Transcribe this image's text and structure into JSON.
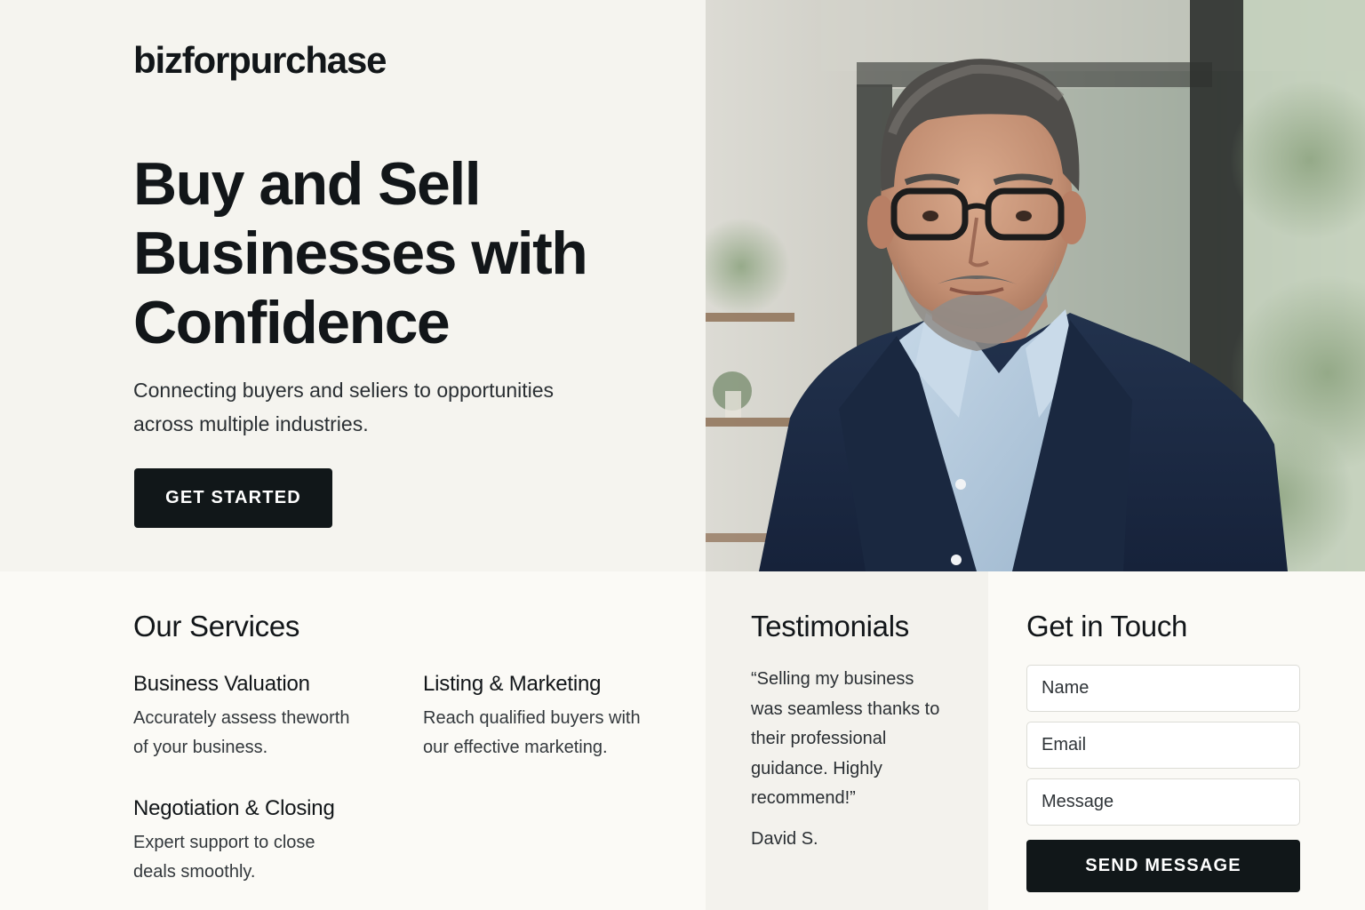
{
  "brand": {
    "logo": "bizforpurchase"
  },
  "hero": {
    "title_lines": [
      "Buy and Sell",
      "Businesses with",
      "Confidence"
    ],
    "subtitle_lines": [
      "Connecting buyers and seliers to opportunities",
      "across multiple industries."
    ],
    "cta_label": "GET STARTED"
  },
  "services": {
    "title": "Our Services",
    "items": [
      {
        "title": "Business Valuation",
        "desc_lines": [
          "Accurately assess theworth",
          "of your business."
        ]
      },
      {
        "title": "Listing & Marketing",
        "desc_lines": [
          "Reach qualified buyers with",
          "our effective marketing."
        ]
      },
      {
        "title": "Negotiation & Closing",
        "desc_lines": [
          "Expert support to close",
          "deals smoothly."
        ]
      }
    ]
  },
  "testimonials": {
    "title": "Testimonials",
    "quote_lines": [
      "“Selling my business",
      "was seamless thanks to",
      "their professional",
      "guidance. Highly",
      "recommend!”"
    ],
    "author": "David S."
  },
  "contact": {
    "title": "Get in Touch",
    "name_placeholder": "Name",
    "email_placeholder": "Email",
    "message_placeholder": "Message",
    "submit_label": "SEND MESSAGE"
  },
  "colors": {
    "primary_dark": "#111719",
    "hero_bg": "#f5f4ef",
    "page_bg": "#faf9f5",
    "suit_navy": "#1d2b44",
    "shirt_blue": "#b7cde0"
  },
  "icons": {
    "hero_image": "businessman-portrait-photo"
  }
}
